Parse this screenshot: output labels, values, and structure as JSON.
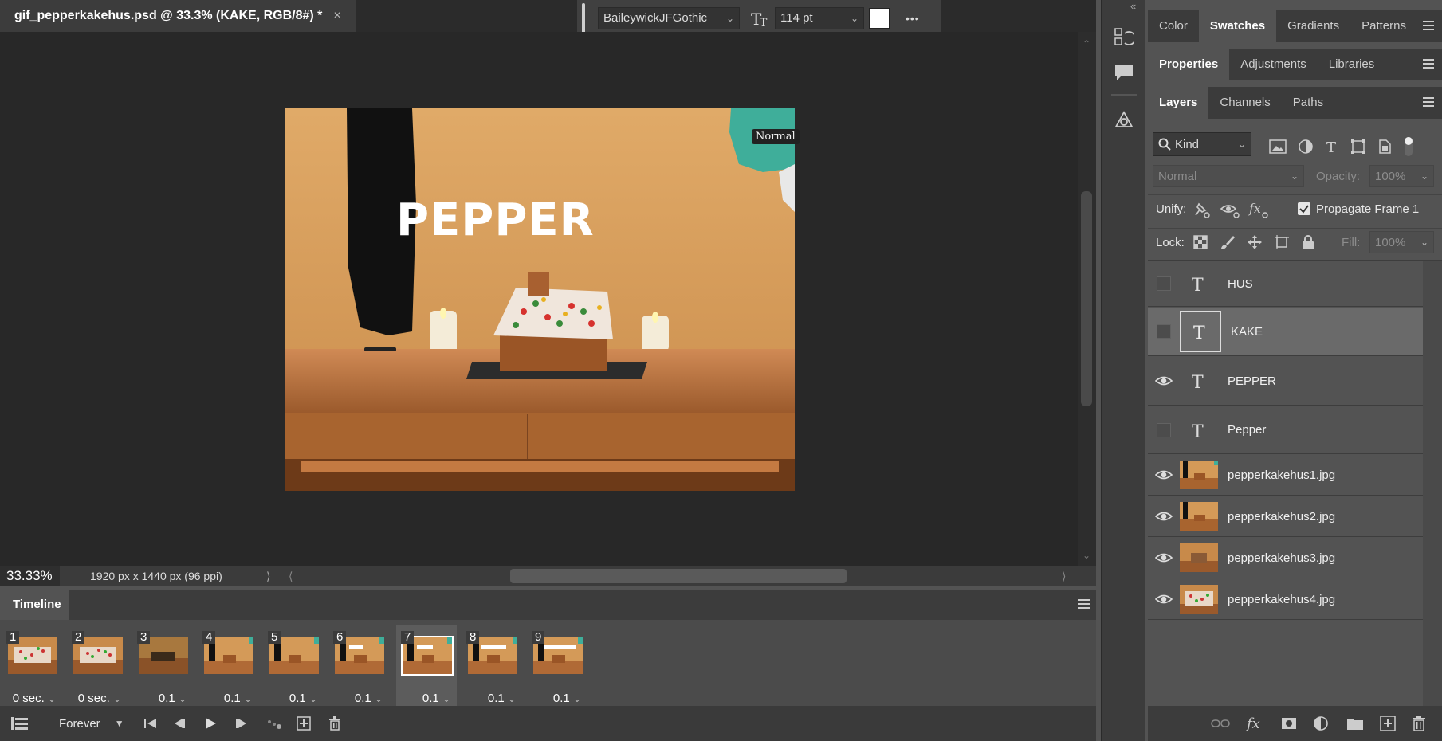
{
  "document_tab": {
    "title": "gif_pepperkakehus.psd @ 33.3% (KAKE, RGB/8#) *",
    "close": "×"
  },
  "options_bar": {
    "font_family": "BaileywickJFGothic",
    "font_size": "114 pt",
    "text_color": "#ffffff",
    "more": "•••"
  },
  "canvas": {
    "image_text": "PEPPER",
    "bag_label": "Normal"
  },
  "status_bar": {
    "zoom": "33.33%",
    "doc_info": "1920 px x 1440 px (96 ppi)"
  },
  "timeline": {
    "title": "Timeline",
    "frames": [
      {
        "num": "1",
        "delay": "0 sec."
      },
      {
        "num": "2",
        "delay": "0 sec."
      },
      {
        "num": "3",
        "delay": "0.1"
      },
      {
        "num": "4",
        "delay": "0.1"
      },
      {
        "num": "5",
        "delay": "0.1"
      },
      {
        "num": "6",
        "delay": "0.1"
      },
      {
        "num": "7",
        "delay": "0.1"
      },
      {
        "num": "8",
        "delay": "0.1"
      },
      {
        "num": "9",
        "delay": "0.1"
      }
    ],
    "selected_frame": "7",
    "loop": "Forever"
  },
  "panels": {
    "top_tabs": [
      "Color",
      "Swatches",
      "Gradients",
      "Patterns"
    ],
    "top_active": "Swatches",
    "mid_tabs": [
      "Properties",
      "Adjustments",
      "Libraries"
    ],
    "mid_active": "Properties",
    "layer_tabs": [
      "Layers",
      "Channels",
      "Paths"
    ],
    "layer_active": "Layers",
    "filter_kind": "Kind",
    "blend_mode": "Normal",
    "opacity_label": "Opacity:",
    "opacity_value": "100%",
    "unify_label": "Unify:",
    "propagate_label": "Propagate Frame 1",
    "lock_label": "Lock:",
    "fill_label": "Fill:",
    "fill_value": "100%"
  },
  "layers": [
    {
      "name": "HUS",
      "type": "text",
      "visible": false
    },
    {
      "name": "KAKE",
      "type": "text",
      "visible": false,
      "selected": true
    },
    {
      "name": "PEPPER",
      "type": "text",
      "visible": true
    },
    {
      "name": "Pepper",
      "type": "text",
      "visible": false
    },
    {
      "name": "pepperkakehus1.jpg",
      "type": "image",
      "visible": true
    },
    {
      "name": "pepperkakehus2.jpg",
      "type": "image",
      "visible": true
    },
    {
      "name": "pepperkakehus3.jpg",
      "type": "image",
      "visible": true
    },
    {
      "name": "pepperkakehus4.jpg",
      "type": "image",
      "visible": true
    }
  ],
  "colors": {
    "accent_swatch": "#ffffff",
    "badge_green": "#3bb96b",
    "wall": "#d9a462",
    "table": "#c8794a"
  }
}
